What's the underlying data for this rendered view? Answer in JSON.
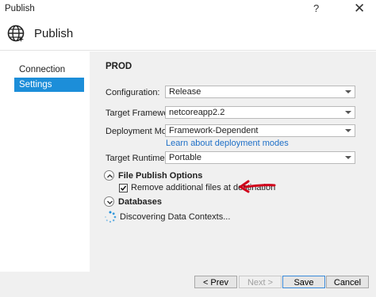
{
  "window": {
    "title": "Publish",
    "help_glyph": "?",
    "close_glyph": "✕"
  },
  "header": {
    "title": "Publish",
    "icon": "globe-icon"
  },
  "sidebar": {
    "items": [
      {
        "label": "Connection",
        "selected": false
      },
      {
        "label": "Settings",
        "selected": true
      }
    ]
  },
  "main": {
    "profile_name": "PROD",
    "fields": [
      {
        "label": "Configuration:",
        "value": "Release"
      },
      {
        "label": "Target Framework:",
        "value": "netcoreapp2.2"
      },
      {
        "label": "Deployment Mode:",
        "value": "Framework-Dependent"
      },
      {
        "label": "Target Runtime:",
        "value": "Portable"
      }
    ],
    "deployment_link": "Learn about deployment modes",
    "file_publish_options": {
      "title": "File Publish Options",
      "expanded": true,
      "remove_files_label": "Remove additional files at destination",
      "remove_files_checked": true
    },
    "databases": {
      "title": "Databases",
      "expanded": false,
      "status": "Discovering Data Contexts..."
    },
    "annotation_color": "#d0021b"
  },
  "footer": {
    "prev_label": "< Prev",
    "next_label": "Next >",
    "save_label": "Save",
    "cancel_label": "Cancel"
  },
  "colors": {
    "accent": "#1c8ed9",
    "link": "#1e6fc7",
    "panel_bg": "#f0f0f0"
  }
}
